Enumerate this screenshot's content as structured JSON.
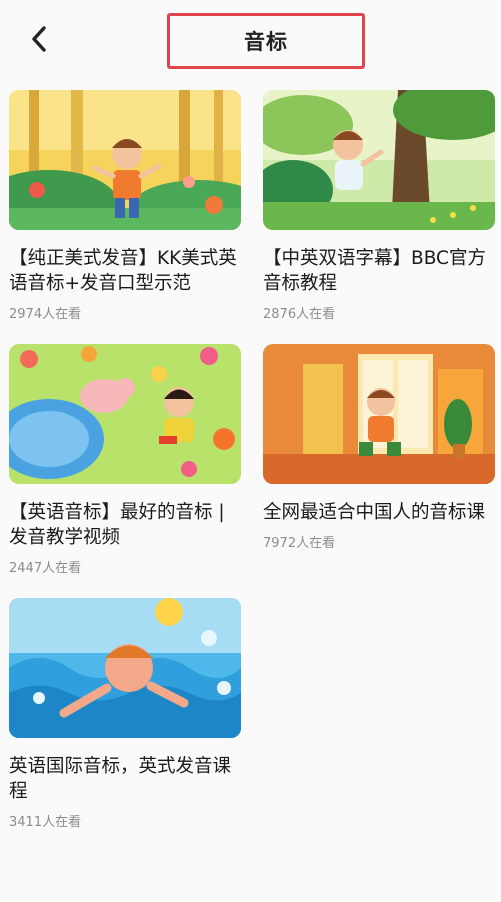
{
  "header": {
    "title": "音标"
  },
  "videos": [
    {
      "title": "【纯正美式发音】KK美式英语音标+发音口型示范",
      "views": "2974人在看"
    },
    {
      "title": "【中英双语字幕】BBC官方音标教程",
      "views": "2876人在看"
    },
    {
      "title": "【英语音标】最好的音标 | 发音教学视频",
      "views": "2447人在看"
    },
    {
      "title": "全网最适合中国人的音标课",
      "views": "7972人在看"
    },
    {
      "title": "英语国际音标，英式发音课程",
      "views": "3411人在看"
    }
  ],
  "colors": {
    "highlight_border": "#e0454f",
    "meta_text": "#8c8c8c"
  },
  "icons": {
    "back": "chevron-left-icon"
  }
}
